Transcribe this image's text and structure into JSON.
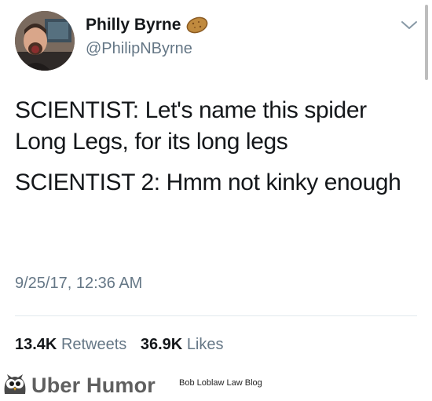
{
  "tweet": {
    "display_name": "Philly Byrne",
    "handle": "@PhilipNByrne",
    "name_emoji_icon": "potato-icon",
    "menu_icon": "chevron-down-icon",
    "text_lines": [
      "SCIENTIST: Let's name this spider Long Legs, for its long legs",
      "SCIENTIST 2: Hmm not kinky enough"
    ],
    "timestamp": "9/25/17, 12:36 AM",
    "retweets_count": "13.4K",
    "retweets_label": "Retweets",
    "likes_count": "36.9K",
    "likes_label": "Likes"
  },
  "footer": {
    "brand": "Uber Humor",
    "credit": "Bob Loblaw Law Blog",
    "logo_icon": "owl-icon"
  },
  "colors": {
    "text_primary": "#14171a",
    "text_secondary": "#657786",
    "divider": "#e1e8ed",
    "brand_gray": "#5f5f5f"
  }
}
